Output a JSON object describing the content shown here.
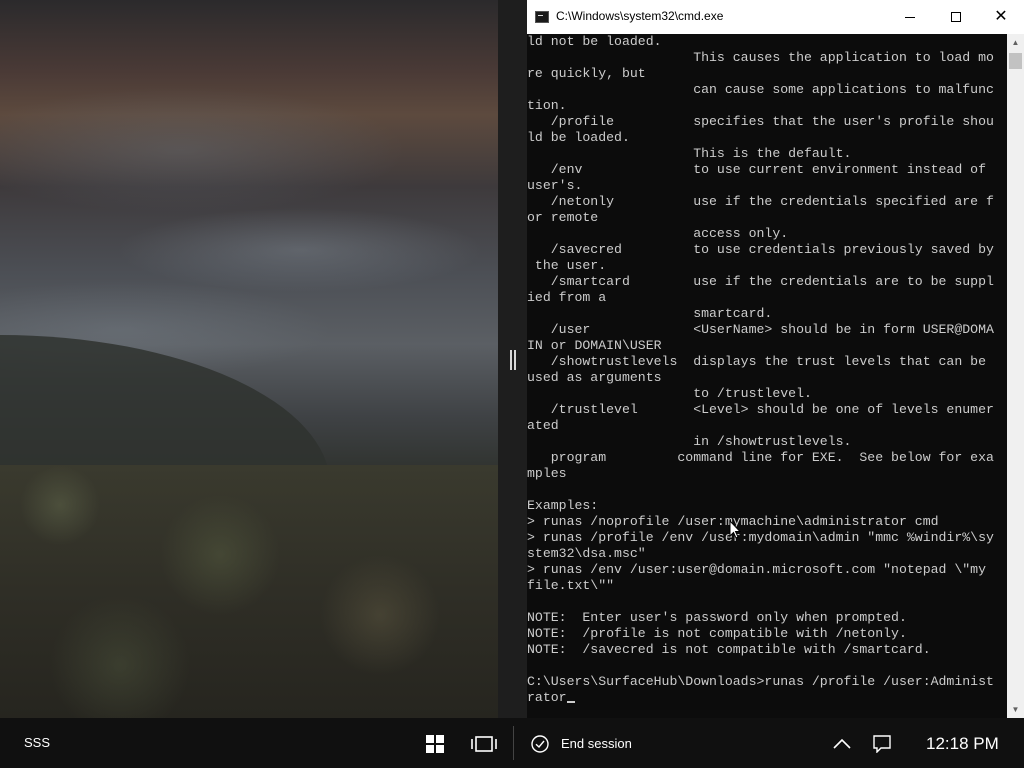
{
  "window": {
    "title": "C:\\Windows\\system32\\cmd.exe",
    "minimize_icon": "minimize-icon",
    "maximize_icon": "maximize-icon",
    "close_glyph": "✕"
  },
  "console": {
    "text": "ld not be loaded.\n                     This causes the application to load mo\nre quickly, but\n                     can cause some applications to malfunc\ntion.\n   /profile          specifies that the user's profile shou\nld be loaded.\n                     This is the default.\n   /env              to use current environment instead of\nuser's.\n   /netonly          use if the credentials specified are f\nor remote\n                     access only.\n   /savecred         to use credentials previously saved by\n the user.\n   /smartcard        use if the credentials are to be suppl\nied from a\n                     smartcard.\n   /user             <UserName> should be in form USER@DOMA\nIN or DOMAIN\\USER\n   /showtrustlevels  displays the trust levels that can be\nused as arguments\n                     to /trustlevel.\n   /trustlevel       <Level> should be one of levels enumer\nated\n                     in /showtrustlevels.\n   program         command line for EXE.  See below for exa\nmples\n\nExamples:\n> runas /noprofile /user:mymachine\\administrator cmd\n> runas /profile /env /user:mydomain\\admin \"mmc %windir%\\sy\nstem32\\dsa.msc\"\n> runas /env /user:user@domain.microsoft.com \"notepad \\\"my\nfile.txt\\\"\"\n\nNOTE:  Enter user's password only when prompted.\nNOTE:  /profile is not compatible with /netonly.\nNOTE:  /savecred is not compatible with /smartcard.\n\nC:\\Users\\SurfaceHub\\Downloads>runas /profile /user:Administ\nrator",
    "background": "#0c0c0c",
    "foreground": "#cccccc"
  },
  "taskbar": {
    "user": "SSS",
    "end_session": "End session",
    "clock": "12:18 PM",
    "icons": [
      "windows-start-icon",
      "task-view-icon",
      "checkmark-circle-icon",
      "chevron-up-icon",
      "notification-icon"
    ]
  }
}
